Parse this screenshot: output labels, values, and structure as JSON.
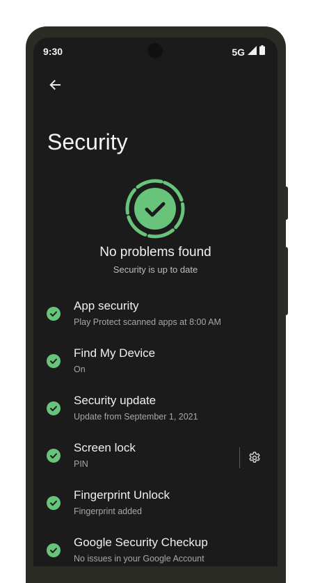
{
  "status_bar": {
    "time": "9:30",
    "network": "5G",
    "icons": [
      "signal-icon",
      "battery-icon"
    ]
  },
  "header": {
    "back_icon": "back-arrow-icon",
    "title": "Security"
  },
  "summary": {
    "icon": "shield-check-icon",
    "title": "No problems found",
    "subtitle": "Security is up to date"
  },
  "items": [
    {
      "title": "App security",
      "subtitle": "Play Protect scanned apps at 8:00 AM",
      "icon": "check-circle-icon"
    },
    {
      "title": "Find My Device",
      "subtitle": "On",
      "icon": "check-circle-icon"
    },
    {
      "title": "Security update",
      "subtitle": "Update from September 1, 2021",
      "icon": "check-circle-icon"
    },
    {
      "title": "Screen lock",
      "subtitle": "PIN",
      "icon": "check-circle-icon",
      "action_icon": "gear-icon"
    },
    {
      "title": "Fingerprint Unlock",
      "subtitle": "Fingerprint added",
      "icon": "check-circle-icon"
    },
    {
      "title": "Google Security Checkup",
      "subtitle": "No issues in your Google Account",
      "icon": "check-circle-icon"
    }
  ],
  "colors": {
    "accent": "#67c47a",
    "background": "#1b1b1b",
    "device": "#2b2c26"
  }
}
